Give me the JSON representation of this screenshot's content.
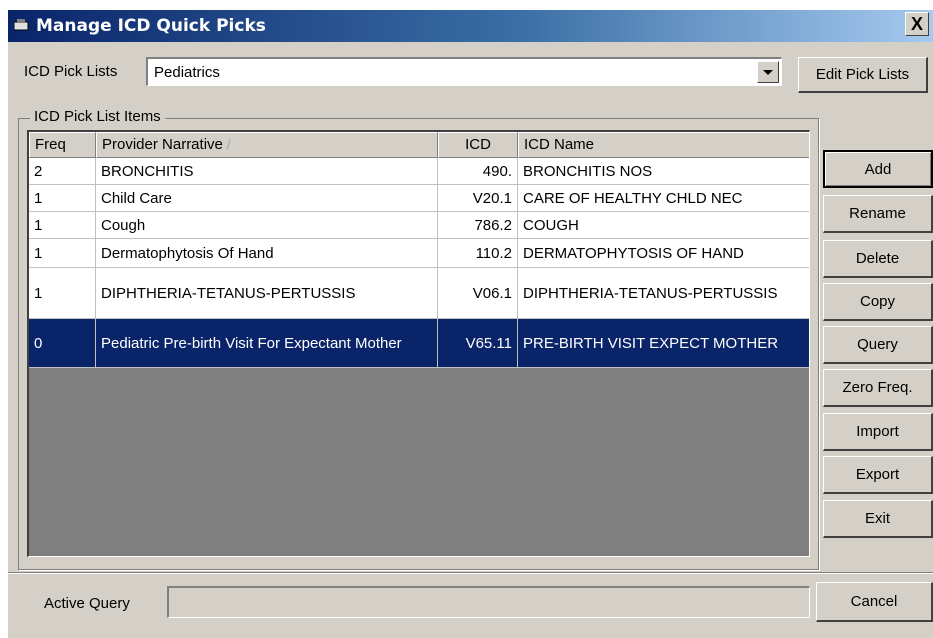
{
  "window": {
    "title": "Manage ICD Quick Picks",
    "close_glyph": "X"
  },
  "picklist": {
    "label": "ICD Pick Lists",
    "value": "Pediatrics",
    "edit_button": "Edit Pick Lists"
  },
  "group": {
    "label": "ICD Pick List Items"
  },
  "table": {
    "headers": {
      "freq": "Freq",
      "narrative": "Provider Narrative",
      "icd": "ICD",
      "icd_name": "ICD Name"
    },
    "sort_indicator": "/",
    "rows": [
      {
        "freq": "2",
        "narrative": "BRONCHITIS",
        "icd": "490.",
        "icd_name": "BRONCHITIS NOS"
      },
      {
        "freq": "1",
        "narrative": "Child Care",
        "icd": "V20.1",
        "icd_name": "CARE OF HEALTHY CHLD NEC"
      },
      {
        "freq": "1",
        "narrative": "Cough",
        "icd": "786.2",
        "icd_name": "COUGH"
      },
      {
        "freq": "1",
        "narrative": "Dermatophytosis Of Hand",
        "icd": "110.2",
        "icd_name": "DERMATOPHYTOSIS OF HAND"
      },
      {
        "freq": "1",
        "narrative": "DIPHTHERIA-TETANUS-PERTUSSIS",
        "icd": "V06.1",
        "icd_name": "DIPHTHERIA-TETANUS-PERTUSSIS"
      },
      {
        "freq": "0",
        "narrative": "Pediatric Pre-birth Visit For Expectant Mother",
        "icd": "V65.11",
        "icd_name": "PRE-BIRTH VISIT EXPECT MOTHER"
      }
    ]
  },
  "buttons": {
    "add": "Add",
    "rename": "Rename",
    "delete": "Delete",
    "copy": "Copy",
    "query": "Query",
    "zero_freq": "Zero Freq.",
    "import": "Import",
    "export": "Export",
    "exit": "Exit",
    "cancel": "Cancel"
  },
  "status": {
    "active_query_label": "Active Query",
    "active_query_value": ""
  },
  "colors": {
    "selection": "#0a246a",
    "face": "#d4d0c8",
    "grid_empty": "#808080"
  }
}
